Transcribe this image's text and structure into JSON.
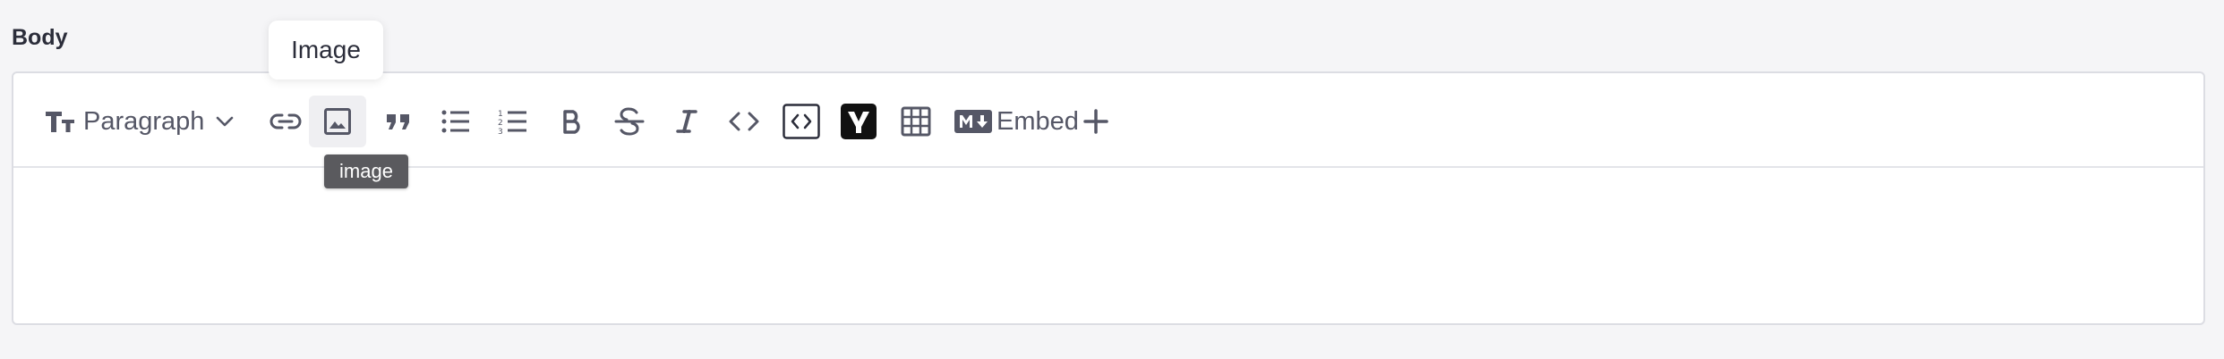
{
  "field": {
    "label": "Body"
  },
  "toolbar": {
    "paragraph_label": "Paragraph",
    "embed_label": "Embed",
    "buttons": [
      {
        "name": "link",
        "icon": "link-icon"
      },
      {
        "name": "image",
        "icon": "image-icon",
        "active": true
      },
      {
        "name": "quote",
        "icon": "quote-icon"
      },
      {
        "name": "bullet-list",
        "icon": "bullet-list-icon"
      },
      {
        "name": "numbered-list",
        "icon": "numbered-list-icon"
      },
      {
        "name": "bold",
        "icon": "bold-icon"
      },
      {
        "name": "strikethrough",
        "icon": "strikethrough-icon"
      },
      {
        "name": "italic",
        "icon": "italic-icon"
      },
      {
        "name": "inline-code",
        "icon": "code-icon"
      },
      {
        "name": "code-block",
        "icon": "code-block-icon"
      },
      {
        "name": "yoast",
        "icon": "yoast-icon"
      },
      {
        "name": "table",
        "icon": "table-icon"
      },
      {
        "name": "markdown",
        "icon": "markdown-icon"
      },
      {
        "name": "embed",
        "icon": "plus-icon"
      }
    ]
  },
  "popover": {
    "text": "Image"
  },
  "tooltip": {
    "text": "image"
  },
  "colors": {
    "page_bg": "#f5f5f7",
    "icon": "#555766",
    "tooltip_bg": "#5a5a5e"
  }
}
